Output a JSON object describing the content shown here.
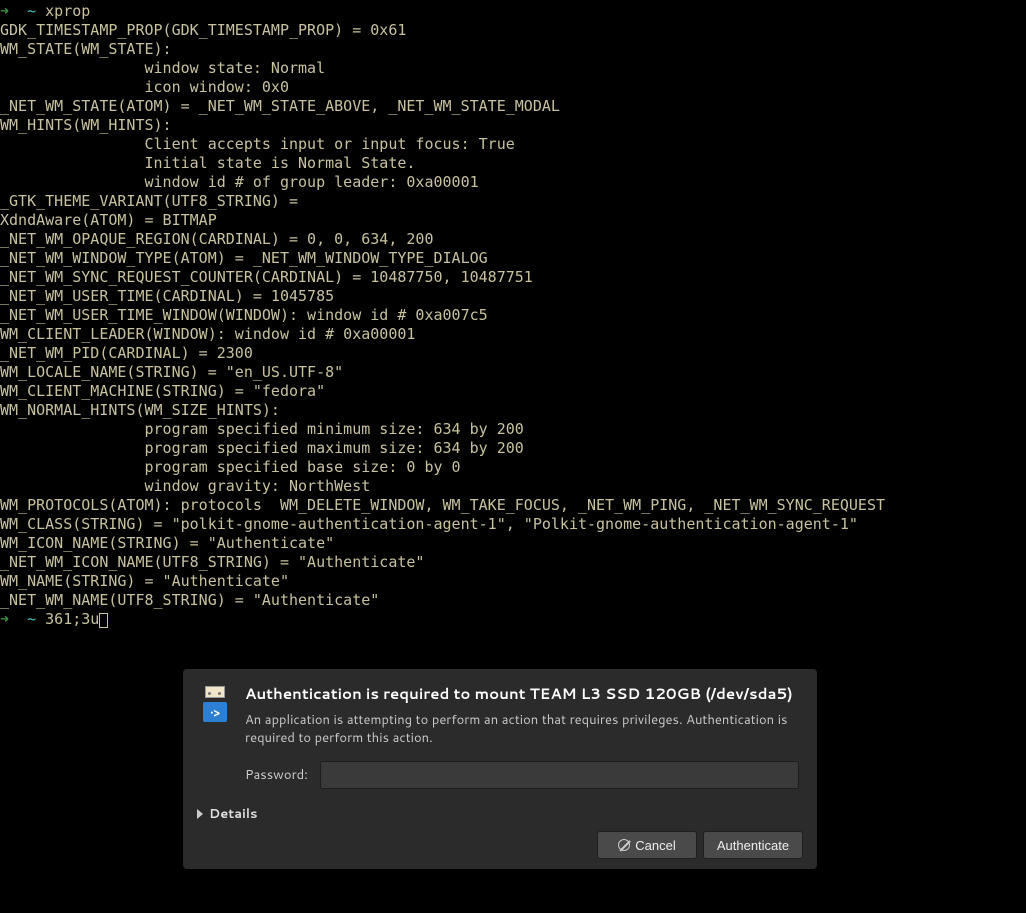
{
  "terminal": {
    "prompt_arrow": "➜",
    "prompt_tilde": "~",
    "command": "xprop",
    "lines": [
      "GDK_TIMESTAMP_PROP(GDK_TIMESTAMP_PROP) = 0x61",
      "WM_STATE(WM_STATE):",
      "                window state: Normal",
      "                icon window: 0x0",
      "_NET_WM_STATE(ATOM) = _NET_WM_STATE_ABOVE, _NET_WM_STATE_MODAL",
      "WM_HINTS(WM_HINTS):",
      "                Client accepts input or input focus: True",
      "                Initial state is Normal State.",
      "                window id # of group leader: 0xa00001",
      "_GTK_THEME_VARIANT(UTF8_STRING) =",
      "XdndAware(ATOM) = BITMAP",
      "_NET_WM_OPAQUE_REGION(CARDINAL) = 0, 0, 634, 200",
      "_NET_WM_WINDOW_TYPE(ATOM) = _NET_WM_WINDOW_TYPE_DIALOG",
      "_NET_WM_SYNC_REQUEST_COUNTER(CARDINAL) = 10487750, 10487751",
      "_NET_WM_USER_TIME(CARDINAL) = 1045785",
      "_NET_WM_USER_TIME_WINDOW(WINDOW): window id # 0xa007c5",
      "WM_CLIENT_LEADER(WINDOW): window id # 0xa00001",
      "_NET_WM_PID(CARDINAL) = 2300",
      "WM_LOCALE_NAME(STRING) = \"en_US.UTF-8\"",
      "WM_CLIENT_MACHINE(STRING) = \"fedora\"",
      "WM_NORMAL_HINTS(WM_SIZE_HINTS):",
      "                program specified minimum size: 634 by 200",
      "                program specified maximum size: 634 by 200",
      "                program specified base size: 0 by 0",
      "                window gravity: NorthWest",
      "WM_PROTOCOLS(ATOM): protocols  WM_DELETE_WINDOW, WM_TAKE_FOCUS, _NET_WM_PING, _NET_WM_SYNC_REQUEST",
      "WM_CLASS(STRING) = \"polkit-gnome-authentication-agent-1\", \"Polkit-gnome-authentication-agent-1\"",
      "WM_ICON_NAME(STRING) = \"Authenticate\"",
      "_NET_WM_ICON_NAME(UTF8_STRING) = \"Authenticate\"",
      "WM_NAME(STRING) = \"Authenticate\"",
      "_NET_WM_NAME(UTF8_STRING) = \"Authenticate\""
    ],
    "prompt2_text": "361;3u"
  },
  "dialog": {
    "title": "Authentication is required to mount TEAM L3 SSD 120GB (/dev/sda5)",
    "description": "An application is attempting to perform an action that requires privileges. Authentication is required to perform this action.",
    "password_label": "Password:",
    "password_value": "",
    "details_label": "Details",
    "cancel_label": "Cancel",
    "authenticate_label": "Authenticate",
    "exec_badge": "·>"
  }
}
